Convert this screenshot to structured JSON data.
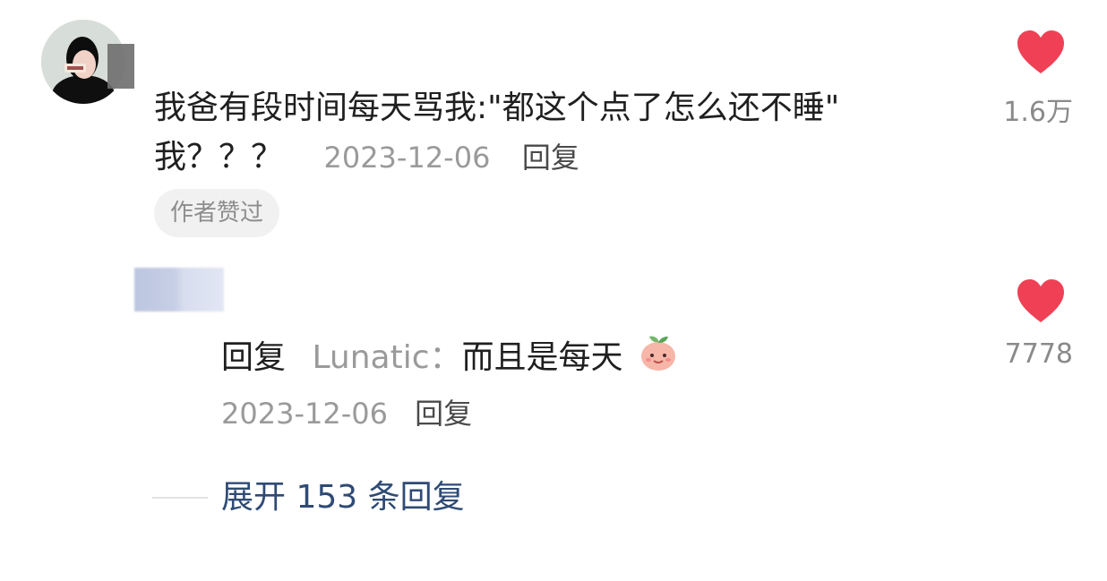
{
  "comment": {
    "text_line1": "我爸有段时间每天骂我:\"都这个点了怎么还不睡\"",
    "text_line2": "我？？？",
    "date": "2023-12-06",
    "reply_label": "回复",
    "badge": "作者赞过",
    "like_count": "1.6万"
  },
  "reply": {
    "prefix": "回复",
    "target_user": "Lunatic",
    "colon": "：",
    "text": "而且是每天",
    "date": "2023-12-06",
    "reply_label": "回复",
    "like_count": "7778"
  },
  "expand": {
    "label": "展开 153 条回复"
  },
  "colors": {
    "like_heart": "#f04055",
    "link_blue": "#2f4a74",
    "meta_gray": "#9a9a9a"
  },
  "icons": {
    "like": "heart-icon",
    "emoji": "peach-smile-icon"
  }
}
